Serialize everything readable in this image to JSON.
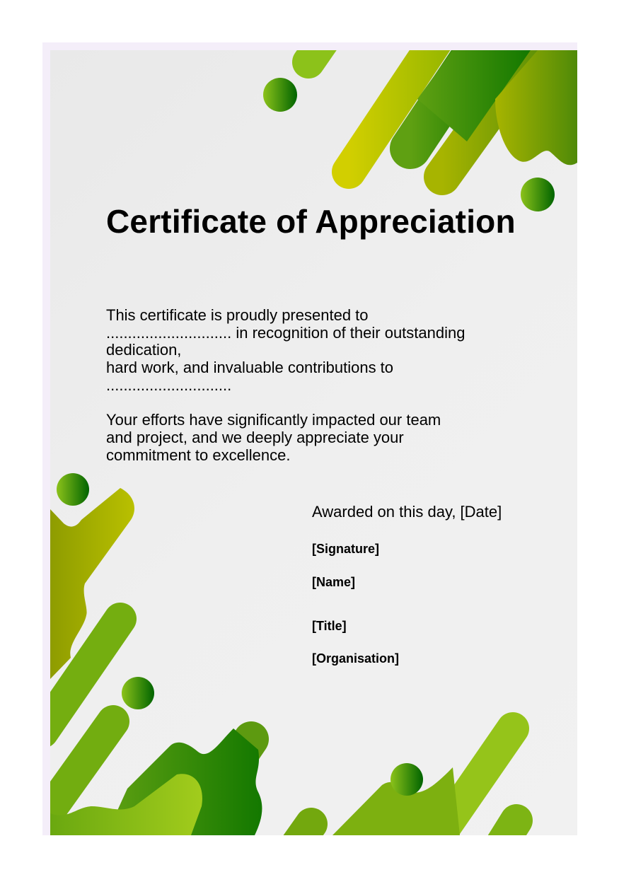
{
  "certificate": {
    "title": "Certificate of Appreciation",
    "body_line_1": "This certificate is proudly presented to",
    "body_line_2": "............................. in recognition of their outstanding",
    "body_line_3": "dedication,",
    "body_line_4": "hard work, and invaluable contributions to",
    "body_line_5": ".............................",
    "body_para_2_line_1": "Your efforts have significantly impacted our team",
    "body_para_2_line_2": "and project, and we deeply appreciate your",
    "body_para_2_line_3": "commitment to excellence.",
    "awarded": "Awarded on this day, [Date]",
    "signature": "[Signature]",
    "name": "[Name]",
    "title_field": "[Title]",
    "organisation": "[Organisation]"
  },
  "colors": {
    "frame": "#f4eef9",
    "light_green": "#8fc21a",
    "yellow_green": "#c7cc00",
    "mid_green": "#4f9a10",
    "dark_green": "#006400",
    "olive": "#7a9a10"
  }
}
